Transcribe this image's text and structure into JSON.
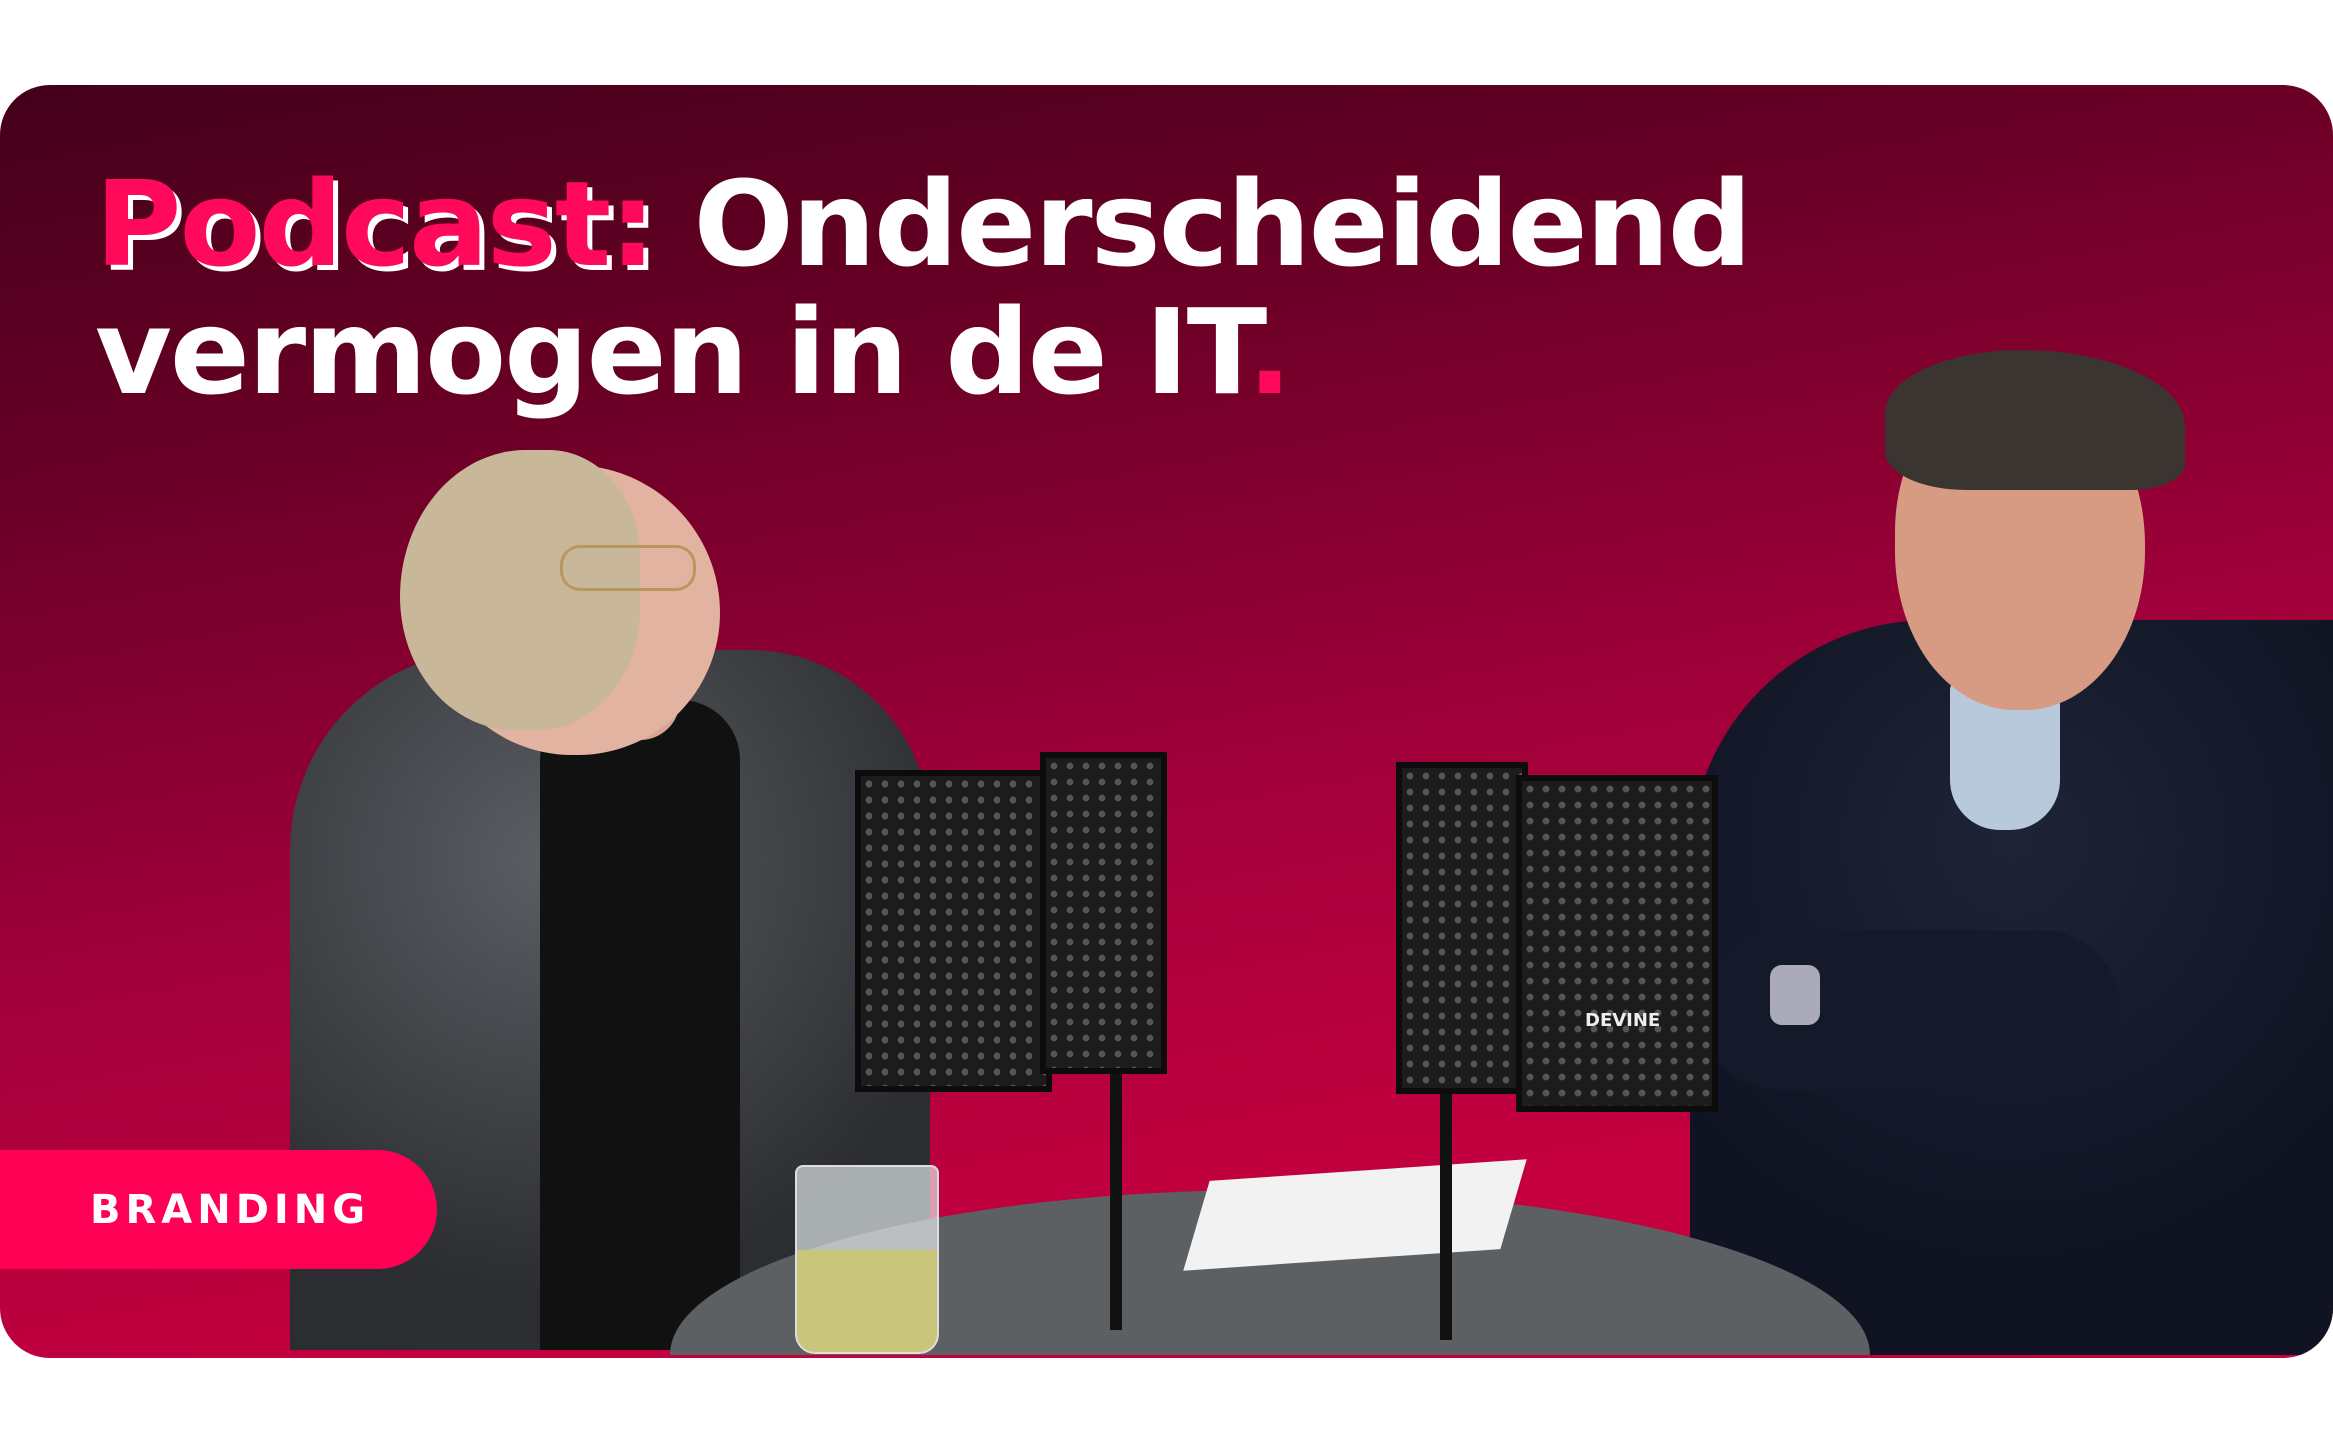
{
  "title": {
    "highlight": "Podcast:",
    "line1_rest": " Onderscheidend",
    "line2": "vermogen in de IT",
    "end_mark": "."
  },
  "photo": {
    "mic_brand": "DEVINE"
  },
  "badge": {
    "label": "BRANDING"
  },
  "colors": {
    "accent": "#ff0055",
    "gradient_top": "#43001a",
    "gradient_bottom": "#c8003f"
  }
}
